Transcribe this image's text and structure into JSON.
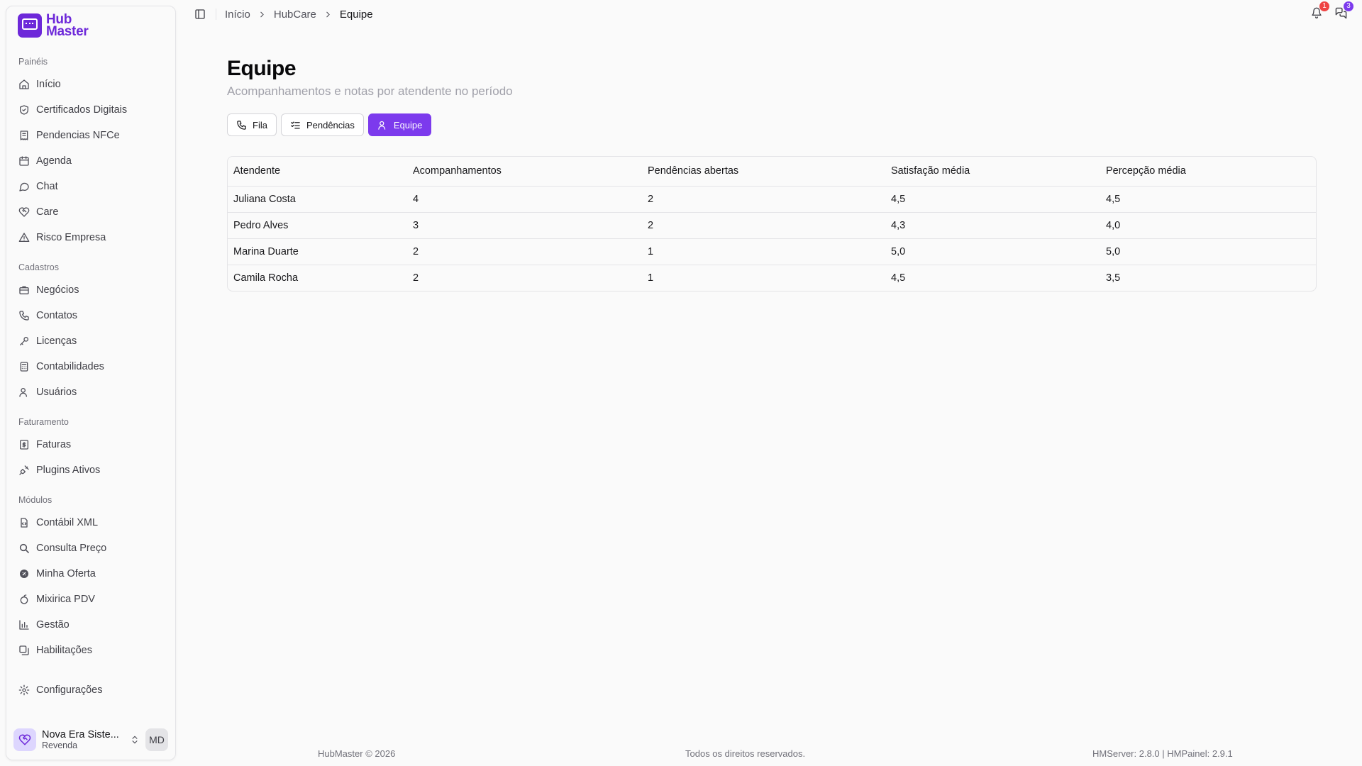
{
  "brand": {
    "line1": "Hub",
    "line2": "Master"
  },
  "sidebar": {
    "sections": [
      {
        "label": "Painéis",
        "items": [
          {
            "label": "Início",
            "icon": "home-icon"
          },
          {
            "label": "Certificados Digitais",
            "icon": "shield-icon"
          },
          {
            "label": "Pendencias NFCe",
            "icon": "receipt-icon"
          },
          {
            "label": "Agenda",
            "icon": "calendar-icon"
          },
          {
            "label": "Chat",
            "icon": "chat-icon"
          },
          {
            "label": "Care",
            "icon": "heart-handshake-icon"
          },
          {
            "label": "Risco Empresa",
            "icon": "warning-icon"
          }
        ]
      },
      {
        "label": "Cadastros",
        "items": [
          {
            "label": "Negócios",
            "icon": "briefcase-icon"
          },
          {
            "label": "Contatos",
            "icon": "phone-icon"
          },
          {
            "label": "Licenças",
            "icon": "key-icon"
          },
          {
            "label": "Contabilidades",
            "icon": "calculator-icon"
          },
          {
            "label": "Usuários",
            "icon": "users-icon"
          }
        ]
      },
      {
        "label": "Faturamento",
        "items": [
          {
            "label": "Faturas",
            "icon": "invoice-icon"
          },
          {
            "label": "Plugins Ativos",
            "icon": "plug-icon"
          }
        ]
      },
      {
        "label": "Módulos",
        "items": [
          {
            "label": "Contábil XML",
            "icon": "file-code-icon"
          },
          {
            "label": "Consulta Preço",
            "icon": "search-price-icon"
          },
          {
            "label": "Minha Oferta",
            "icon": "badge-percent-icon"
          },
          {
            "label": "Mixirica PDV",
            "icon": "citrus-icon"
          },
          {
            "label": "Gestão",
            "icon": "bar-chart-icon"
          },
          {
            "label": "Habilitações",
            "icon": "layers-icon"
          }
        ]
      }
    ],
    "settings": {
      "label": "Configurações",
      "icon": "gear-icon"
    },
    "org": {
      "name": "Nova Era Siste...",
      "role": "Revenda",
      "avatar": "MD"
    }
  },
  "breadcrumb": [
    "Início",
    "HubCare",
    "Equipe"
  ],
  "notifications": {
    "bell_count": "1",
    "messages_count": "3"
  },
  "page": {
    "title": "Equipe",
    "subtitle": "Acompanhamentos e notas por atendente no período"
  },
  "tabs": [
    {
      "label": "Fila",
      "icon": "phone-icon",
      "active": false
    },
    {
      "label": "Pendências",
      "icon": "list-checks-icon",
      "active": false
    },
    {
      "label": "Equipe",
      "icon": "users-icon",
      "active": true
    }
  ],
  "table": {
    "columns": [
      "Atendente",
      "Acompanhamentos",
      "Pendências abertas",
      "Satisfação média",
      "Percepção média"
    ],
    "rows": [
      [
        "Juliana Costa",
        "4",
        "2",
        "4,5",
        "4,5"
      ],
      [
        "Pedro Alves",
        "3",
        "2",
        "4,3",
        "4,0"
      ],
      [
        "Marina Duarte",
        "2",
        "1",
        "5,0",
        "5,0"
      ],
      [
        "Camila Rocha",
        "2",
        "1",
        "4,5",
        "3,5"
      ]
    ]
  },
  "footer": {
    "left": "HubMaster © 2026",
    "center": "Todos os direitos reservados.",
    "right": "HMServer: 2.8.0 | HMPainel: 2.9.1"
  }
}
